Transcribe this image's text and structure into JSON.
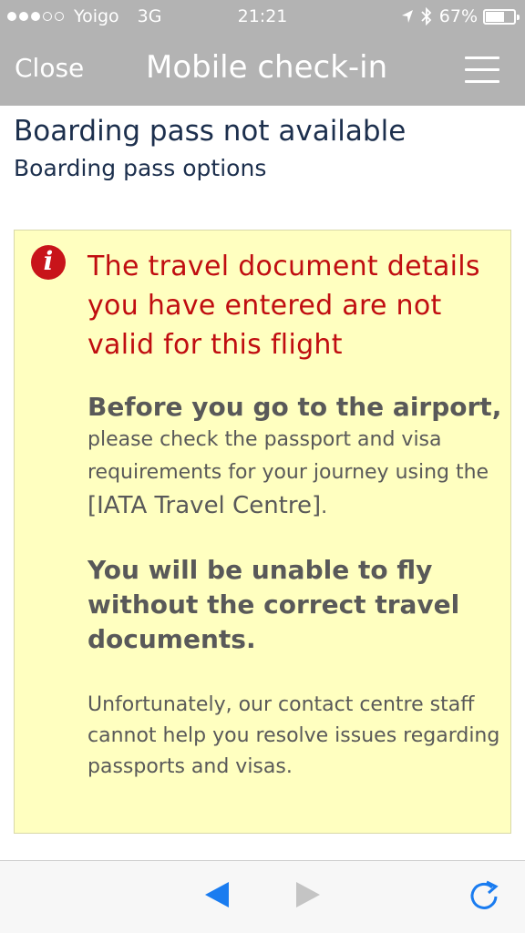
{
  "status_bar": {
    "carrier": "Yoigo",
    "network": "3G",
    "time": "21:21",
    "battery": "67%",
    "battery_level": 0.67,
    "signal_bars_filled": 3,
    "signal_bars_total": 5
  },
  "nav": {
    "close_label": "Close",
    "title": "Mobile check-in",
    "menu_icon": "hamburger-menu-icon"
  },
  "header": {
    "title": "Boarding pass not available",
    "subtitle": "Boarding pass options"
  },
  "alert": {
    "icon": "info-icon",
    "icon_glyph": "i",
    "title": "The travel document details you have entered are not valid for this flight",
    "para1_head": "Before you go to the airport,",
    "para1_text": "please check the passport and visa requirements for your journey using the",
    "para1_link": "[IATA Travel Centre]",
    "para1_end": ".",
    "para2": "You will be unable to fly without the correct travel documents.",
    "para3": "Unfortunately, our contact centre staff cannot help you resolve issues regarding passports and visas."
  },
  "toolbar": {
    "back_icon": "back-arrow-icon",
    "forward_icon": "forward-arrow-icon",
    "reload_icon": "reload-icon"
  },
  "colors": {
    "bar_gray": "#b3b3b3",
    "alert_red": "#c00d10",
    "panel_yellow": "#ffffc0",
    "title_navy": "#1c2f4d",
    "ios_blue": "#1a7cf0"
  }
}
